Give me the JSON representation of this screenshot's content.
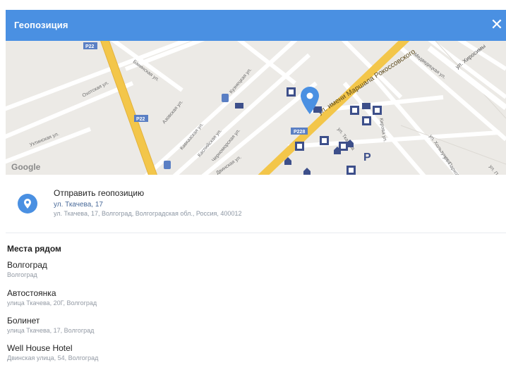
{
  "dialog": {
    "title": "Геопозиция",
    "close_icon": "close-icon"
  },
  "map": {
    "streets": [
      "ул. имени Маршала Рокоссовского",
      "ул. Хиросимы",
      "Бакинская ул.",
      "Кузнецкая ул.",
      "Каспийская ул.",
      "Азовская ул.",
      "Кавказская ул.",
      "Черноморская ул.",
      "Ухтинская ул.",
      "Двинская ул.",
      "Охотская ул.",
      "ул. Ткачева",
      "Кирова ул.",
      "Медведицкая ул.",
      "ул. Хользунова",
      "ул. Пархоменко",
      "ул. Пархоменко"
    ],
    "road_shields": [
      "Р228",
      "Р22",
      "Р22"
    ],
    "parking_label": "P",
    "logo": "Google",
    "colors": {
      "background": "#eceae6",
      "highway": "#f3c64a",
      "marker": "#4a90e2",
      "poi": "#3d4f8a"
    }
  },
  "send_location": {
    "icon": "location-pin-icon",
    "label": "Отправить геопозицию",
    "street": "ул. Ткачева, 17",
    "full_address": "ул. Ткачева, 17, Волгоград, Волгоградская обл., Россия, 400012"
  },
  "nearby": {
    "title": "Места рядом",
    "places": [
      {
        "name": "Волгоград",
        "address": "Волгоград"
      },
      {
        "name": "Автостоянка",
        "address": "улица Ткачева, 20Г, Волгоград"
      },
      {
        "name": "Болинет",
        "address": "улица Ткачева, 17, Волгоград"
      },
      {
        "name": "Well House Hotel",
        "address": "Двинская улица, 54, Волгоград"
      }
    ]
  },
  "colors": {
    "accent": "#4a90e2",
    "title_text": "#ffffff",
    "secondary_text": "#939aa4"
  }
}
